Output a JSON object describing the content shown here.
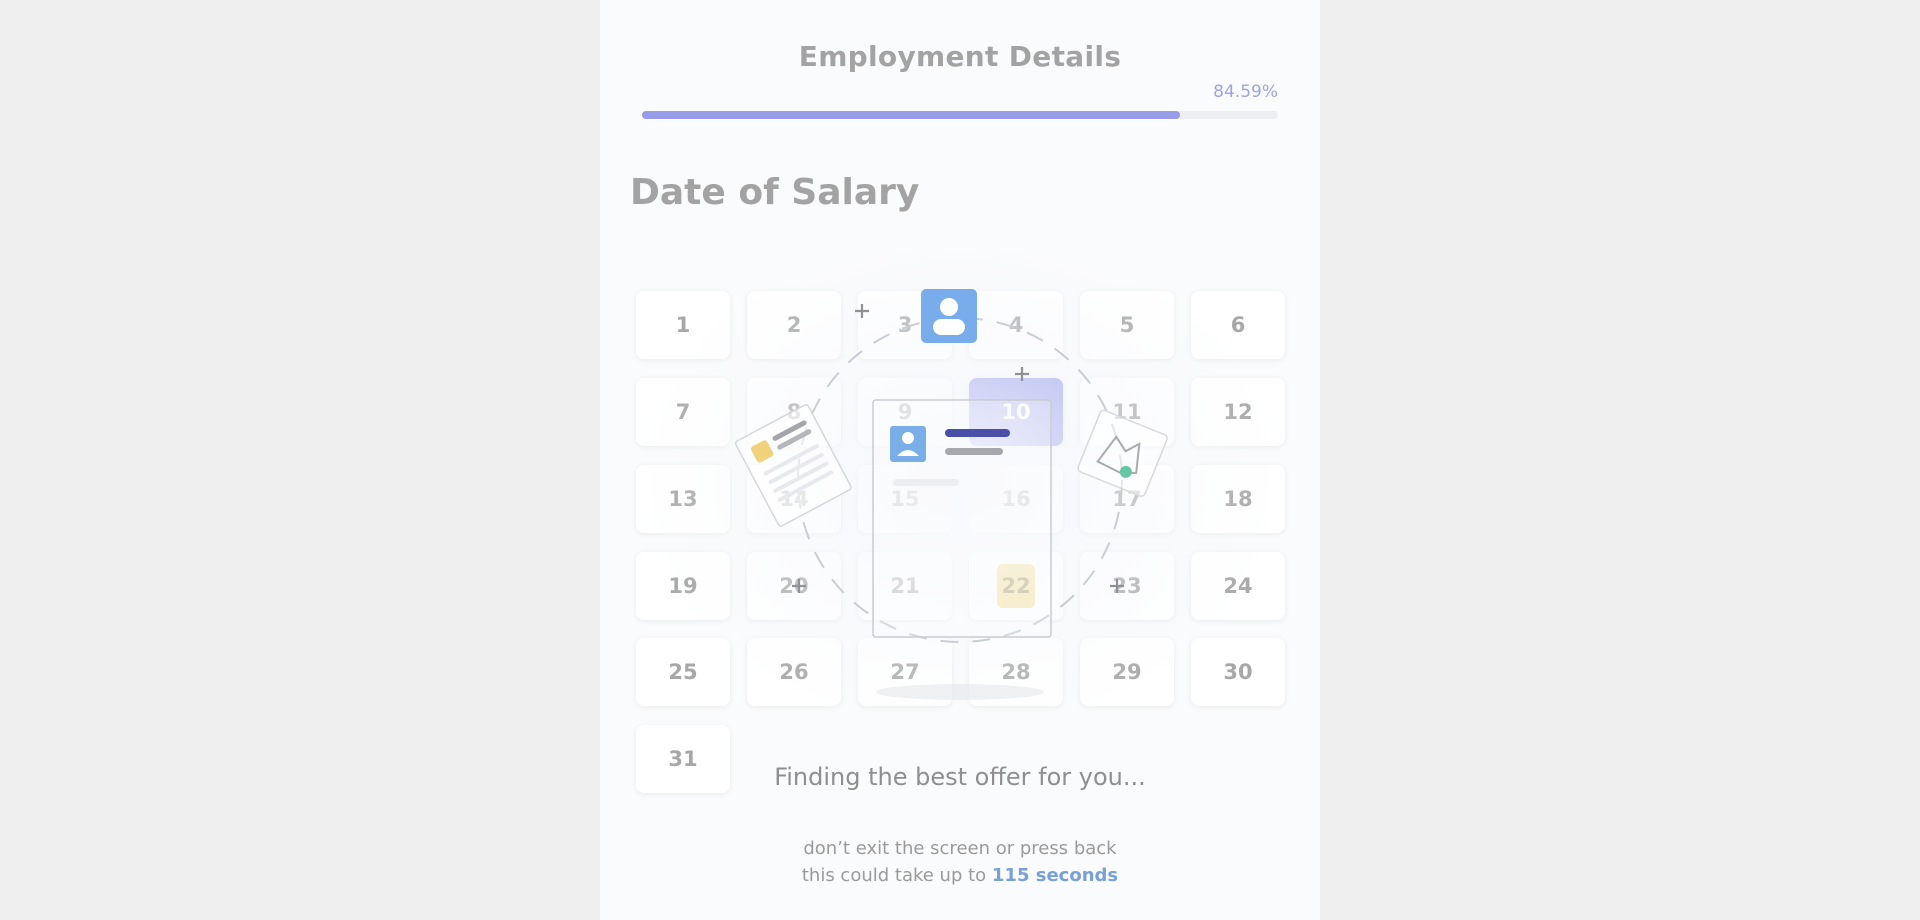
{
  "header": {
    "title": "Employment Details"
  },
  "progress": {
    "label": "84.59%",
    "value": 84.59,
    "color": "#979ce8"
  },
  "section": {
    "title": "Date of Salary"
  },
  "calendar": {
    "days": [
      "1",
      "2",
      "3",
      "4",
      "5",
      "6",
      "7",
      "8",
      "9",
      "10",
      "11",
      "12",
      "13",
      "14",
      "15",
      "16",
      "17",
      "18",
      "19",
      "20",
      "21",
      "22",
      "23",
      "24",
      "25",
      "26",
      "27",
      "28",
      "29",
      "30",
      "31"
    ],
    "selected_day": "10",
    "highlighted_day": "22",
    "selected_color": "#9fa3ec",
    "highlight_color": "#f2dc8e"
  },
  "loader": {
    "message": "Finding the best offer for you...",
    "hint_line1": "don’t exit the screen or press back",
    "hint_line2_prefix": "this could take up to ",
    "hint_line2_accent": "115 seconds",
    "accent_color": "#78a0d6",
    "icons": [
      "user-icon",
      "document-icon",
      "map-pin-icon"
    ]
  }
}
